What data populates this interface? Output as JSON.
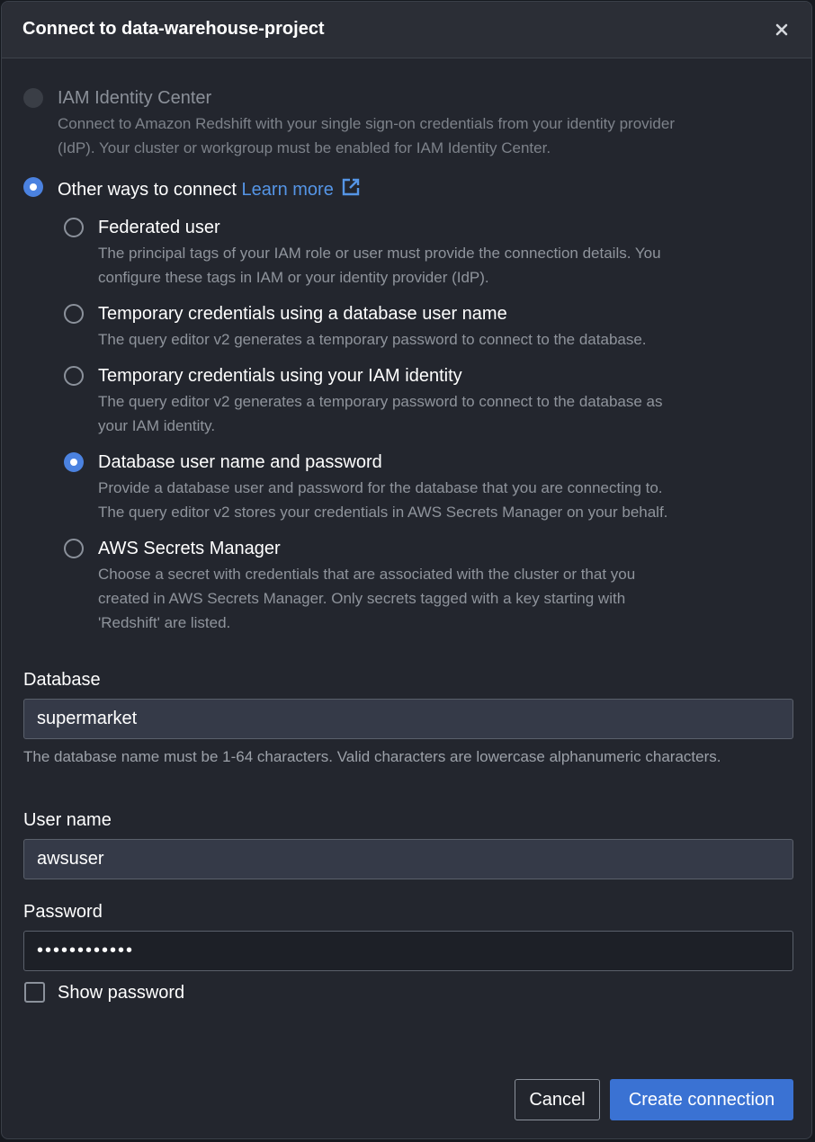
{
  "modal": {
    "title": "Connect to data-warehouse-project",
    "close_icon": "close-icon"
  },
  "auth": {
    "iam_identity_center": {
      "label": "IAM Identity Center",
      "description": [
        "Connect to Amazon Redshift with your single sign-on credentials from your identity provider",
        "(IdP). Your cluster or workgroup must be enabled for IAM Identity Center."
      ],
      "state": "disabled"
    },
    "other_ways": {
      "label": "Other ways to connect",
      "link_text": "Learn more",
      "link_icon": "external-link-icon",
      "state": "selected"
    },
    "options": [
      {
        "label": "Federated user",
        "description": [
          "The principal tags of your IAM role or user must provide the connection details. You",
          "configure these tags in IAM or your identity provider (IdP)."
        ],
        "selected": false
      },
      {
        "label": "Temporary credentials using a database user name",
        "description": [
          "The query editor v2 generates a temporary password to connect to the database."
        ],
        "selected": false
      },
      {
        "label": "Temporary credentials using your IAM identity",
        "description": [
          "The query editor v2 generates a temporary password to connect to the database as",
          "your IAM identity."
        ],
        "selected": false
      },
      {
        "label": "Database user name and password",
        "description": [
          "Provide a database user and password for the database that you are connecting to.",
          "The query editor v2 stores your credentials in AWS Secrets Manager on your behalf."
        ],
        "selected": true
      },
      {
        "label": "AWS Secrets Manager",
        "description": [
          "Choose a secret with credentials that are associated with the cluster or that you",
          "created in AWS Secrets Manager. Only secrets tagged with a key starting with",
          "'Redshift' are listed."
        ],
        "selected": false
      }
    ]
  },
  "form": {
    "database": {
      "label": "Database",
      "value": "supermarket",
      "help": "The database name must be 1-64 characters. Valid characters are lowercase alphanumeric characters."
    },
    "username": {
      "label": "User name",
      "value": "awsuser"
    },
    "password": {
      "label": "Password",
      "value": "••••••••••••"
    },
    "show_password": {
      "label": "Show password",
      "checked": false
    }
  },
  "footer": {
    "cancel_label": "Cancel",
    "create_label": "Create connection"
  },
  "colors": {
    "accent": "#4b82e0",
    "primary_button": "#3a72d3",
    "link": "#5595e6",
    "background": "#23262e"
  }
}
